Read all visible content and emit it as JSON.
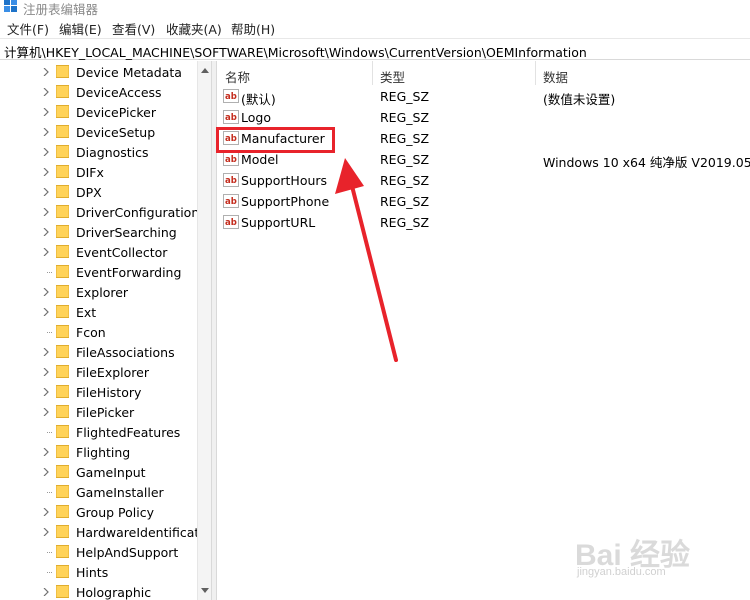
{
  "window": {
    "title": "注册表编辑器",
    "icon": "regedit-icon"
  },
  "menu": [
    "文件(F)",
    "编辑(E)",
    "查看(V)",
    "收藏夹(A)",
    "帮助(H)"
  ],
  "address": "计算机\\HKEY_LOCAL_MACHINE\\SOFTWARE\\Microsoft\\Windows\\CurrentVersion\\OEMInformation",
  "tree": {
    "items": [
      {
        "label": "Device Metadata",
        "expandable": true
      },
      {
        "label": "DeviceAccess",
        "expandable": true
      },
      {
        "label": "DevicePicker",
        "expandable": true
      },
      {
        "label": "DeviceSetup",
        "expandable": true
      },
      {
        "label": "Diagnostics",
        "expandable": true
      },
      {
        "label": "DIFx",
        "expandable": true
      },
      {
        "label": "DPX",
        "expandable": true
      },
      {
        "label": "DriverConfiguration",
        "expandable": true
      },
      {
        "label": "DriverSearching",
        "expandable": true
      },
      {
        "label": "EventCollector",
        "expandable": true
      },
      {
        "label": "EventForwarding",
        "expandable": false
      },
      {
        "label": "Explorer",
        "expandable": true
      },
      {
        "label": "Ext",
        "expandable": true
      },
      {
        "label": "Fcon",
        "expandable": false
      },
      {
        "label": "FileAssociations",
        "expandable": true
      },
      {
        "label": "FileExplorer",
        "expandable": true
      },
      {
        "label": "FileHistory",
        "expandable": true
      },
      {
        "label": "FilePicker",
        "expandable": true
      },
      {
        "label": "FlightedFeatures",
        "expandable": false
      },
      {
        "label": "Flighting",
        "expandable": true
      },
      {
        "label": "GameInput",
        "expandable": true
      },
      {
        "label": "GameInstaller",
        "expandable": false
      },
      {
        "label": "Group Policy",
        "expandable": true
      },
      {
        "label": "HardwareIdentificati",
        "expandable": true
      },
      {
        "label": "HelpAndSupport",
        "expandable": false
      },
      {
        "label": "Hints",
        "expandable": false
      },
      {
        "label": "Holographic",
        "expandable": true
      }
    ]
  },
  "values": {
    "columns": {
      "name": "名称",
      "type": "类型",
      "data": "数据"
    },
    "rows": [
      {
        "name": "(默认)",
        "type": "REG_SZ",
        "data": "(数值未设置)"
      },
      {
        "name": "Logo",
        "type": "REG_SZ",
        "data": ""
      },
      {
        "name": "Manufacturer",
        "type": "REG_SZ",
        "data": ""
      },
      {
        "name": "Model",
        "type": "REG_SZ",
        "data": "Windows 10 x64 纯净版 V2019.05"
      },
      {
        "name": "SupportHours",
        "type": "REG_SZ",
        "data": ""
      },
      {
        "name": "SupportPhone",
        "type": "REG_SZ",
        "data": ""
      },
      {
        "name": "SupportURL",
        "type": "REG_SZ",
        "data": ""
      }
    ]
  },
  "annotation": {
    "color": "#e8232b",
    "highlighted_value": "Manufacturer"
  },
  "watermark": {
    "brand": "Bai 经验",
    "url": "jingyan.baidu.com"
  }
}
